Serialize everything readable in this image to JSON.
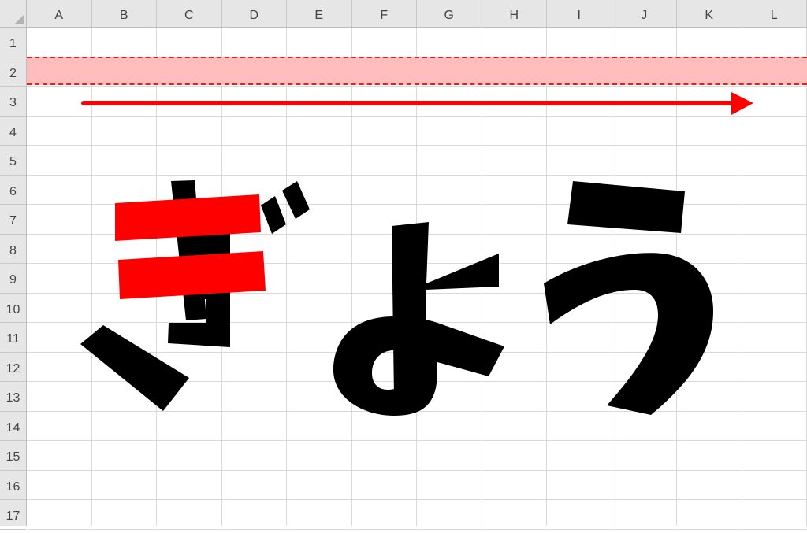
{
  "spreadsheet": {
    "columns": [
      "A",
      "B",
      "C",
      "D",
      "E",
      "F",
      "G",
      "H",
      "I",
      "J",
      "K",
      "L"
    ],
    "rows": [
      "1",
      "2",
      "3",
      "4",
      "5",
      "6",
      "7",
      "8",
      "9",
      "10",
      "11",
      "12",
      "13",
      "14",
      "15",
      "16",
      "17"
    ]
  },
  "colors": {
    "highlight_fill": "#ffbdbd",
    "highlight_border": "#e02020",
    "arrow": "#ff0000",
    "stroke_black": "#000000",
    "stroke_red": "#ff0000"
  },
  "artwork": {
    "characters": [
      "ぎ",
      "よ",
      "う"
    ],
    "icons": [
      "right-arrow-icon"
    ]
  }
}
